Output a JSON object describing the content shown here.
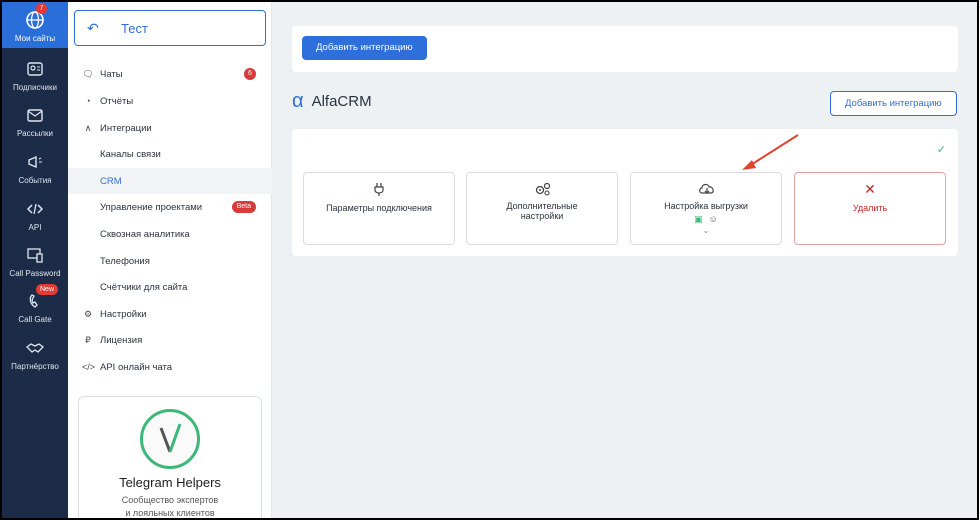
{
  "rail": {
    "items": [
      {
        "label": "Мои сайты",
        "badge": "7"
      },
      {
        "label": "Подписчики"
      },
      {
        "label": "Рассылки"
      },
      {
        "label": "События"
      },
      {
        "label": "API"
      },
      {
        "label": "Call Password"
      },
      {
        "label": "Call Gate",
        "badge": "New"
      },
      {
        "label": "Партнёрство"
      }
    ]
  },
  "sidebar": {
    "back_title": "Тест",
    "items": [
      {
        "label": "Чаты",
        "badge": "6"
      },
      {
        "label": "Отчёты"
      },
      {
        "label": "Интеграции"
      },
      {
        "label": "Каналы связи"
      },
      {
        "label": "CRM"
      },
      {
        "label": "Управление проектами",
        "badge": "Beta"
      },
      {
        "label": "Сквозная аналитика"
      },
      {
        "label": "Телефония"
      },
      {
        "label": "Счётчики для сайта"
      },
      {
        "label": "Настройки"
      },
      {
        "label": "Лицензия"
      },
      {
        "label": "API онлайн чата"
      }
    ],
    "promo": {
      "title": "Telegram Helpers",
      "subtitle_line1": "Сообщество экспертов",
      "subtitle_line2": "и лояльных клиентов"
    }
  },
  "main": {
    "top_button": "Добавить интеграцию",
    "crm_name": "AlfaCRM",
    "crm_symbol": "α",
    "add_button": "Добавить интеграцию",
    "tiles": [
      {
        "label": "Параметры подключения",
        "icon": "plug-icon"
      },
      {
        "label_line1": "Дополнительные",
        "label_line2": "настройки",
        "icon": "gears-icon"
      },
      {
        "label": "Настройка выгрузки",
        "icon": "cloud-download-icon"
      },
      {
        "label": "Удалить",
        "icon": "close-icon"
      }
    ]
  },
  "colors": {
    "accent": "#2f6fdb",
    "rail": "#1c2c48",
    "danger": "#c62828",
    "success": "#3cb878"
  }
}
